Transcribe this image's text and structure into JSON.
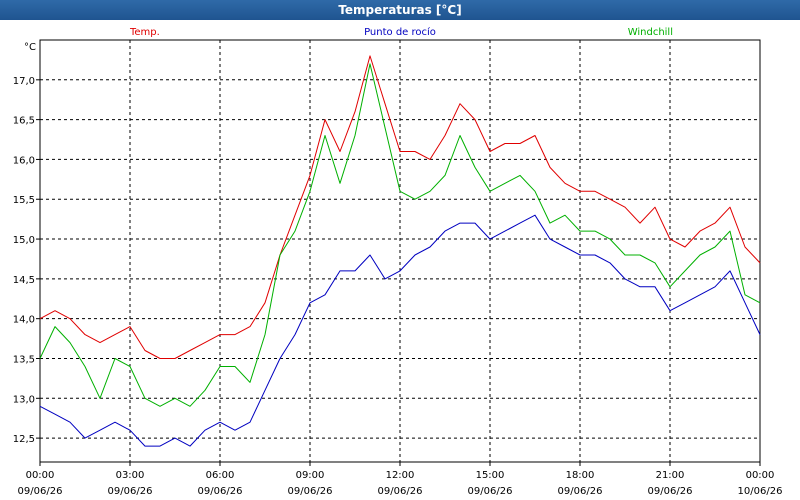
{
  "window": {
    "title": "Temperaturas [°C]"
  },
  "chart_data": {
    "type": "line",
    "title": "Temperaturas [°C]",
    "ylabel": "°C",
    "ylim": [
      12.2,
      17.5
    ],
    "xlim_hours": [
      0,
      24
    ],
    "grid": true,
    "legend_placement": "top",
    "y_ticks": [
      "17,0",
      "16,5",
      "16,0",
      "15,5",
      "15,0",
      "14,5",
      "14,0",
      "13,5",
      "13,0",
      "12,5"
    ],
    "y_tick_values": [
      17.0,
      16.5,
      16.0,
      15.5,
      15.0,
      14.5,
      14.0,
      13.5,
      13.0,
      12.5
    ],
    "x_ticks": [
      {
        "time": "00:00",
        "date": "09/06/26"
      },
      {
        "time": "03:00",
        "date": "09/06/26"
      },
      {
        "time": "06:00",
        "date": "09/06/26"
      },
      {
        "time": "09:00",
        "date": "09/06/26"
      },
      {
        "time": "12:00",
        "date": "09/06/26"
      },
      {
        "time": "15:00",
        "date": "09/06/26"
      },
      {
        "time": "18:00",
        "date": "09/06/26"
      },
      {
        "time": "21:00",
        "date": "09/06/26"
      },
      {
        "time": "00:00",
        "date": "10/06/26"
      }
    ],
    "series": [
      {
        "name": "Temp.",
        "color": "#e00000",
        "x": [
          0,
          0.5,
          1,
          1.5,
          2,
          2.5,
          3,
          3.5,
          4,
          4.5,
          5,
          5.5,
          6,
          6.5,
          7,
          7.5,
          8,
          8.5,
          9,
          9.5,
          10,
          10.5,
          11,
          11.5,
          12,
          12.5,
          13,
          13.5,
          14,
          14.5,
          15,
          15.5,
          16,
          16.5,
          17,
          17.5,
          18,
          18.5,
          19,
          19.5,
          20,
          20.5,
          21,
          21.5,
          22,
          22.5,
          23,
          23.5,
          24
        ],
        "values": [
          14.0,
          14.1,
          14.0,
          13.8,
          13.7,
          13.8,
          13.9,
          13.6,
          13.5,
          13.5,
          13.6,
          13.7,
          13.8,
          13.8,
          13.9,
          14.2,
          14.8,
          15.3,
          15.8,
          16.5,
          16.1,
          16.6,
          17.3,
          16.7,
          16.1,
          16.1,
          16.0,
          16.3,
          16.7,
          16.5,
          16.1,
          16.2,
          16.2,
          16.3,
          15.9,
          15.7,
          15.6,
          15.6,
          15.5,
          15.4,
          15.2,
          15.4,
          15.0,
          14.9,
          15.1,
          15.2,
          15.4,
          14.9,
          14.7
        ]
      },
      {
        "name": "Punto de rocío",
        "color": "#0000c0",
        "x": [
          0,
          0.5,
          1,
          1.5,
          2,
          2.5,
          3,
          3.5,
          4,
          4.5,
          5,
          5.5,
          6,
          6.5,
          7,
          7.5,
          8,
          8.5,
          9,
          9.5,
          10,
          10.5,
          11,
          11.5,
          12,
          12.5,
          13,
          13.5,
          14,
          14.5,
          15,
          15.5,
          16,
          16.5,
          17,
          17.5,
          18,
          18.5,
          19,
          19.5,
          20,
          20.5,
          21,
          21.5,
          22,
          22.5,
          23,
          23.5,
          24
        ],
        "values": [
          12.9,
          12.8,
          12.7,
          12.5,
          12.6,
          12.7,
          12.6,
          12.4,
          12.4,
          12.5,
          12.4,
          12.6,
          12.7,
          12.6,
          12.7,
          13.1,
          13.5,
          13.8,
          14.2,
          14.3,
          14.6,
          14.6,
          14.8,
          14.5,
          14.6,
          14.8,
          14.9,
          15.1,
          15.2,
          15.2,
          15.0,
          15.1,
          15.2,
          15.3,
          15.0,
          14.9,
          14.8,
          14.8,
          14.7,
          14.5,
          14.4,
          14.4,
          14.1,
          14.2,
          14.3,
          14.4,
          14.6,
          14.2,
          13.8
        ]
      },
      {
        "name": "Windchill",
        "color": "#00b000",
        "x": [
          0,
          0.5,
          1,
          1.5,
          2,
          2.5,
          3,
          3.5,
          4,
          4.5,
          5,
          5.5,
          6,
          6.5,
          7,
          7.5,
          8,
          8.5,
          9,
          9.5,
          10,
          10.5,
          11,
          11.5,
          12,
          12.5,
          13,
          13.5,
          14,
          14.5,
          15,
          15.5,
          16,
          16.5,
          17,
          17.5,
          18,
          18.5,
          19,
          19.5,
          20,
          20.5,
          21,
          21.5,
          22,
          22.5,
          23,
          23.5,
          24
        ],
        "values": [
          13.5,
          13.9,
          13.7,
          13.4,
          13.0,
          13.5,
          13.4,
          13.0,
          12.9,
          13.0,
          12.9,
          13.1,
          13.4,
          13.4,
          13.2,
          13.8,
          14.8,
          15.1,
          15.6,
          16.3,
          15.7,
          16.3,
          17.2,
          16.4,
          15.6,
          15.5,
          15.6,
          15.8,
          16.3,
          15.9,
          15.6,
          15.7,
          15.8,
          15.6,
          15.2,
          15.3,
          15.1,
          15.1,
          15.0,
          14.8,
          14.8,
          14.7,
          14.4,
          14.6,
          14.8,
          14.9,
          15.1,
          14.3,
          14.2
        ]
      }
    ]
  }
}
